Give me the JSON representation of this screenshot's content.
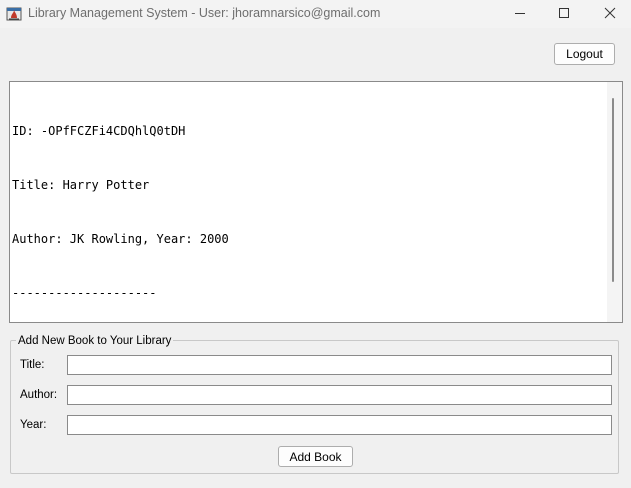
{
  "window": {
    "title": "Library Management System - User: jhoramnarsico@gmail.com",
    "icon": "java-app-icon",
    "controls": [
      "minimize-icon",
      "maximize-icon",
      "close-icon"
    ]
  },
  "header": {
    "logout_label": "Logout"
  },
  "output": {
    "lines": [
      "ID: -OPfFCZFi4CDQhlQ0tDH",
      "Title: Harry Potter",
      "Author: JK Rowling, Year: 2000",
      "--------------------"
    ]
  },
  "add_book_form": {
    "group_title": "Add New Book to Your Library",
    "title_label": "Title:",
    "title_value": "",
    "author_label": "Author:",
    "author_value": "",
    "year_label": "Year:",
    "year_value": "",
    "submit_label": "Add Book"
  }
}
